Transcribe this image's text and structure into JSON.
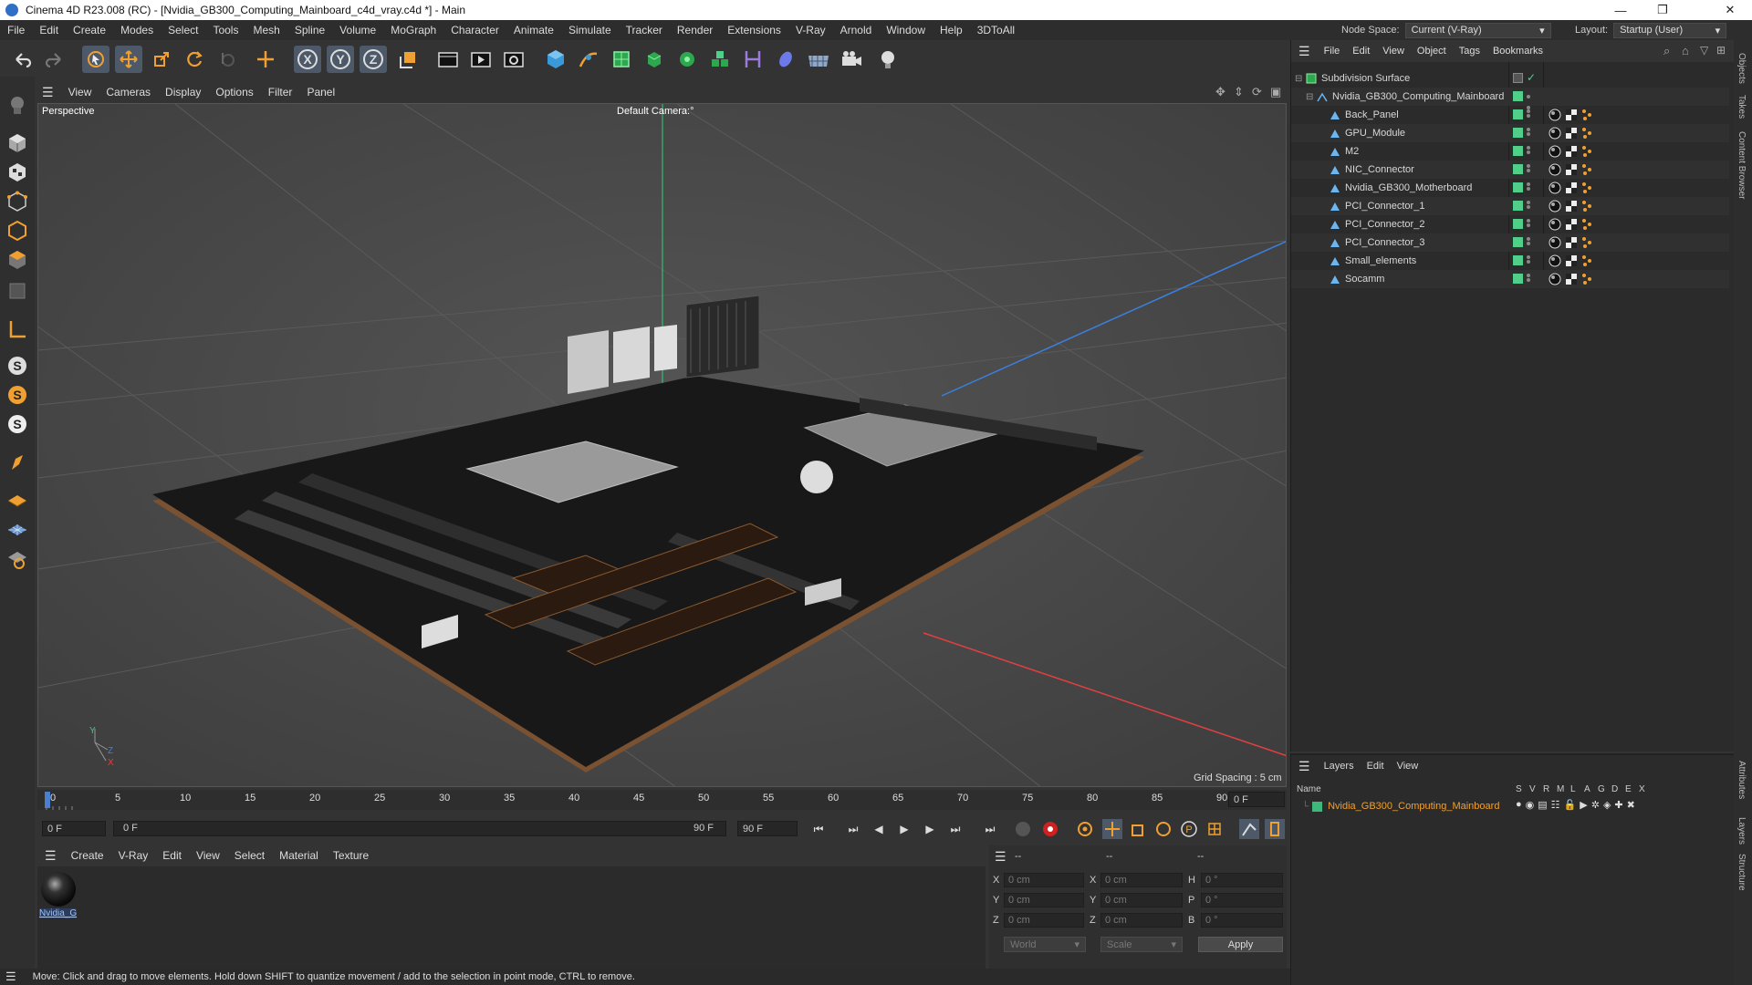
{
  "window": {
    "title": "Cinema 4D R23.008 (RC) - [Nvidia_GB300_Computing_Mainboard_c4d_vray.c4d *] - Main",
    "minimize": "—",
    "maximize": "❐",
    "close": "✕"
  },
  "menubar": {
    "items": [
      "File",
      "Edit",
      "Create",
      "Modes",
      "Select",
      "Tools",
      "Mesh",
      "Spline",
      "Volume",
      "MoGraph",
      "Character",
      "Animate",
      "Simulate",
      "Tracker",
      "Render",
      "Extensions",
      "V-Ray",
      "Arnold",
      "Window",
      "Help",
      "3DToAll"
    ],
    "node_space_label": "Node Space:",
    "node_space_value": "Current (V-Ray)",
    "layout_label": "Layout:",
    "layout_value": "Startup (User)"
  },
  "viewport": {
    "menu": [
      "View",
      "Cameras",
      "Display",
      "Options",
      "Filter",
      "Panel"
    ],
    "name": "Perspective",
    "camera": "Default Camera",
    "camera_suffix": ":°",
    "grid_spacing": "Grid Spacing : 5 cm",
    "axis_y": "Y",
    "axis_z": "Z",
    "axis_x": "X"
  },
  "timeline": {
    "ticks": [
      "0",
      "5",
      "10",
      "15",
      "20",
      "25",
      "30",
      "35",
      "40",
      "45",
      "50",
      "55",
      "60",
      "65",
      "70",
      "75",
      "80",
      "85",
      "90"
    ],
    "current_frame_field": "0 F",
    "start_field": "0 F",
    "range_start": "0 F",
    "range_end": "90 F",
    "end_field": "90 F"
  },
  "material_manager": {
    "menu": [
      "Create",
      "V-Ray",
      "Edit",
      "View",
      "Select",
      "Material",
      "Texture"
    ],
    "material_name": "Nvidia_G"
  },
  "coordinates": {
    "header_dashes": [
      "--",
      "--",
      "--"
    ],
    "rows": [
      {
        "axis": "X",
        "pos": "0 cm",
        "axis2": "X",
        "size": "0 cm",
        "rot_axis": "H",
        "rot": "0 °"
      },
      {
        "axis": "Y",
        "pos": "0 cm",
        "axis2": "Y",
        "size": "0 cm",
        "rot_axis": "P",
        "rot": "0 °"
      },
      {
        "axis": "Z",
        "pos": "0 cm",
        "axis2": "Z",
        "size": "0 cm",
        "rot_axis": "B",
        "rot": "0 °"
      }
    ],
    "mode": "World",
    "scale": "Scale",
    "apply": "Apply"
  },
  "status": "Move: Click and drag to move elements. Hold down SHIFT to quantize movement / add to the selection in point mode, CTRL to remove.",
  "object_manager": {
    "menu": [
      "File",
      "Edit",
      "View",
      "Object",
      "Tags",
      "Bookmarks"
    ],
    "root": "Subdivision Surface",
    "group": "Nvidia_GB300_Computing_Mainboard",
    "children": [
      "Back_Panel",
      "GPU_Module",
      "M2",
      "NIC_Connector",
      "Nvidia_GB300_Motherboard",
      "PCI_Connector_1",
      "PCI_Connector_2",
      "PCI_Connector_3",
      "Small_elements",
      "Socamm"
    ]
  },
  "layer_manager": {
    "menu": [
      "Layers",
      "Edit",
      "View"
    ],
    "col_name": "Name",
    "cols": [
      "S",
      "V",
      "R",
      "M",
      "L",
      "A",
      "G",
      "D",
      "E",
      "X"
    ],
    "layer_name": "Nvidia_GB300_Computing_Mainboard",
    "layer_color": "#3db87a"
  },
  "side_tabs": [
    "Objects",
    "Takes",
    "Content Browser",
    "Attributes",
    "Layers",
    "Structure"
  ],
  "colors": {
    "accent_orange": "#f0a030",
    "selected_blue": "#4d5968",
    "green_tag": "#4fcf8a"
  }
}
